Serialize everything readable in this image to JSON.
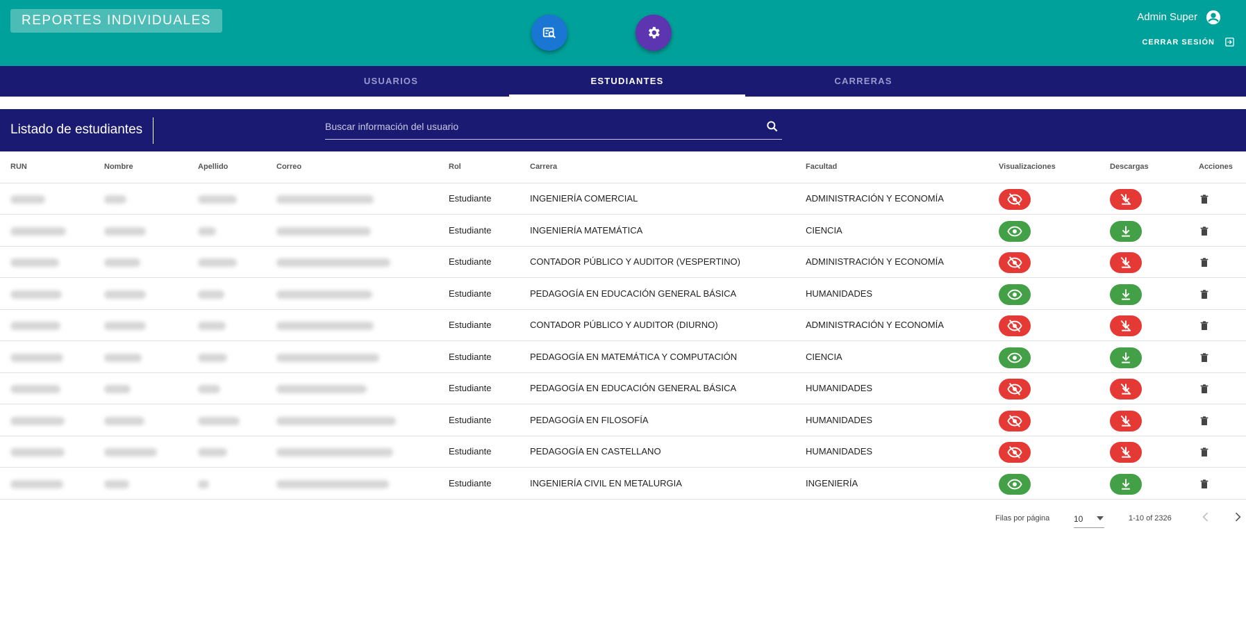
{
  "header": {
    "title": "REPORTES INDIVIDUALES",
    "user_name": "Admin Super",
    "logout_label": "CERRAR SESIÓN"
  },
  "tabs": [
    {
      "label": "USUARIOS",
      "active": false
    },
    {
      "label": "ESTUDIANTES",
      "active": true
    },
    {
      "label": "CARRERAS",
      "active": false
    }
  ],
  "list": {
    "title": "Listado de estudiantes",
    "search_placeholder": "Buscar información del usuario"
  },
  "table": {
    "columns": [
      "RUN",
      "Nombre",
      "Apellido",
      "Correo",
      "Rol",
      "Carrera",
      "Facultad",
      "Visualizaciones",
      "Descargas",
      "Acciones"
    ],
    "rows": [
      {
        "rol": "Estudiante",
        "carrera": "INGENIERÍA COMERCIAL",
        "facultad": "ADMINISTRACIÓN Y ECONOMÍA",
        "enabled": false
      },
      {
        "rol": "Estudiante",
        "carrera": "INGENIERÍA MATEMÁTICA",
        "facultad": "CIENCIA",
        "enabled": true
      },
      {
        "rol": "Estudiante",
        "carrera": "CONTADOR PÚBLICO Y AUDITOR (VESPERTINO)",
        "facultad": "ADMINISTRACIÓN Y ECONOMÍA",
        "enabled": false
      },
      {
        "rol": "Estudiante",
        "carrera": "PEDAGOGÍA EN EDUCACIÓN GENERAL BÁSICA",
        "facultad": "HUMANIDADES",
        "enabled": true
      },
      {
        "rol": "Estudiante",
        "carrera": "CONTADOR PÚBLICO Y AUDITOR (DIURNO)",
        "facultad": "ADMINISTRACIÓN Y ECONOMÍA",
        "enabled": false
      },
      {
        "rol": "Estudiante",
        "carrera": "PEDAGOGÍA EN MATEMÁTICA Y COMPUTACIÓN",
        "facultad": "CIENCIA",
        "enabled": true
      },
      {
        "rol": "Estudiante",
        "carrera": "PEDAGOGÍA EN EDUCACIÓN GENERAL BÁSICA",
        "facultad": "HUMANIDADES",
        "enabled": false
      },
      {
        "rol": "Estudiante",
        "carrera": "PEDAGOGÍA EN FILOSOFÍA",
        "facultad": "HUMANIDADES",
        "enabled": false
      },
      {
        "rol": "Estudiante",
        "carrera": "PEDAGOGÍA EN CASTELLANO",
        "facultad": "HUMANIDADES",
        "enabled": false
      },
      {
        "rol": "Estudiante",
        "carrera": "INGENIERÍA CIVIL EN METALURGIA",
        "facultad": "INGENIERÍA",
        "enabled": true
      }
    ]
  },
  "pagination": {
    "rows_per_page_label": "Filas por página",
    "rows_per_page": "10",
    "range": "1-10 of 2326"
  },
  "colors": {
    "header_bg": "#00a19a",
    "nav_bg": "#1a1a72",
    "enabled": "#43a047",
    "disabled": "#e53935"
  }
}
